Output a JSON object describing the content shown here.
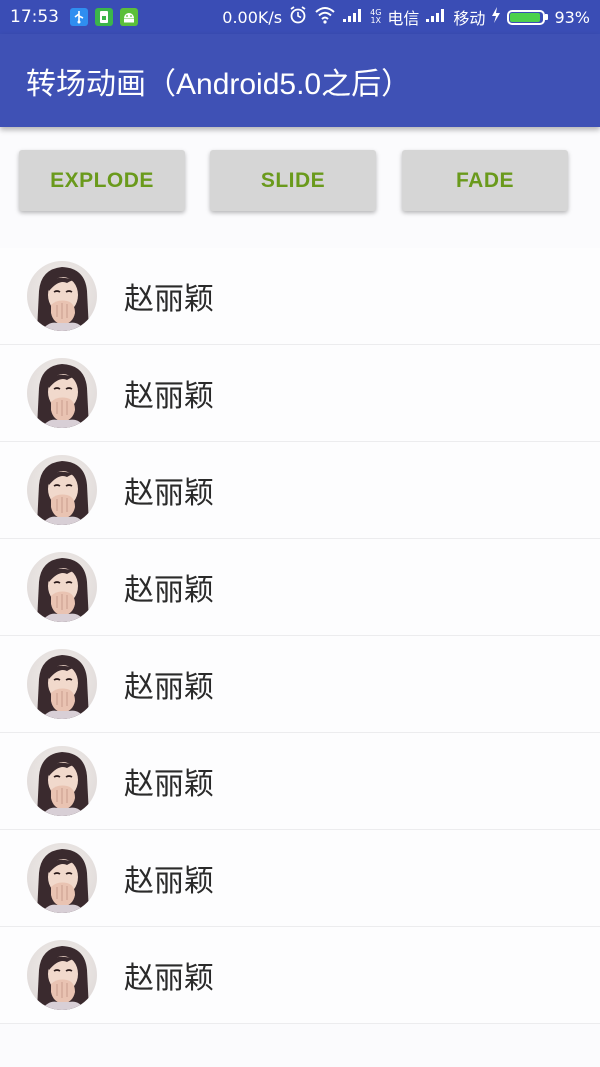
{
  "status_bar": {
    "time": "17:53",
    "net_speed": "0.00K/s",
    "network_type_top": "4G",
    "network_type_bottom": "1X",
    "carrier1": "电信",
    "carrier2": "移动",
    "battery": "93%",
    "battery_level": 0.93,
    "icons": [
      "usb-icon",
      "sim-icon",
      "android-icon",
      "alarm-icon",
      "wifi-icon",
      "signal-icon",
      "charging-icon",
      "battery-icon"
    ]
  },
  "app_bar": {
    "title": "转场动画（Android5.0之后）",
    "color": "#3f51b5"
  },
  "buttons": [
    {
      "label": "EXPLODE"
    },
    {
      "label": "SLIDE"
    },
    {
      "label": "FADE"
    }
  ],
  "button_text_color": "#6a9a1c",
  "list": {
    "items": [
      {
        "name": "赵丽颖"
      },
      {
        "name": "赵丽颖"
      },
      {
        "name": "赵丽颖"
      },
      {
        "name": "赵丽颖"
      },
      {
        "name": "赵丽颖"
      },
      {
        "name": "赵丽颖"
      },
      {
        "name": "赵丽颖"
      },
      {
        "name": "赵丽颖"
      }
    ]
  }
}
